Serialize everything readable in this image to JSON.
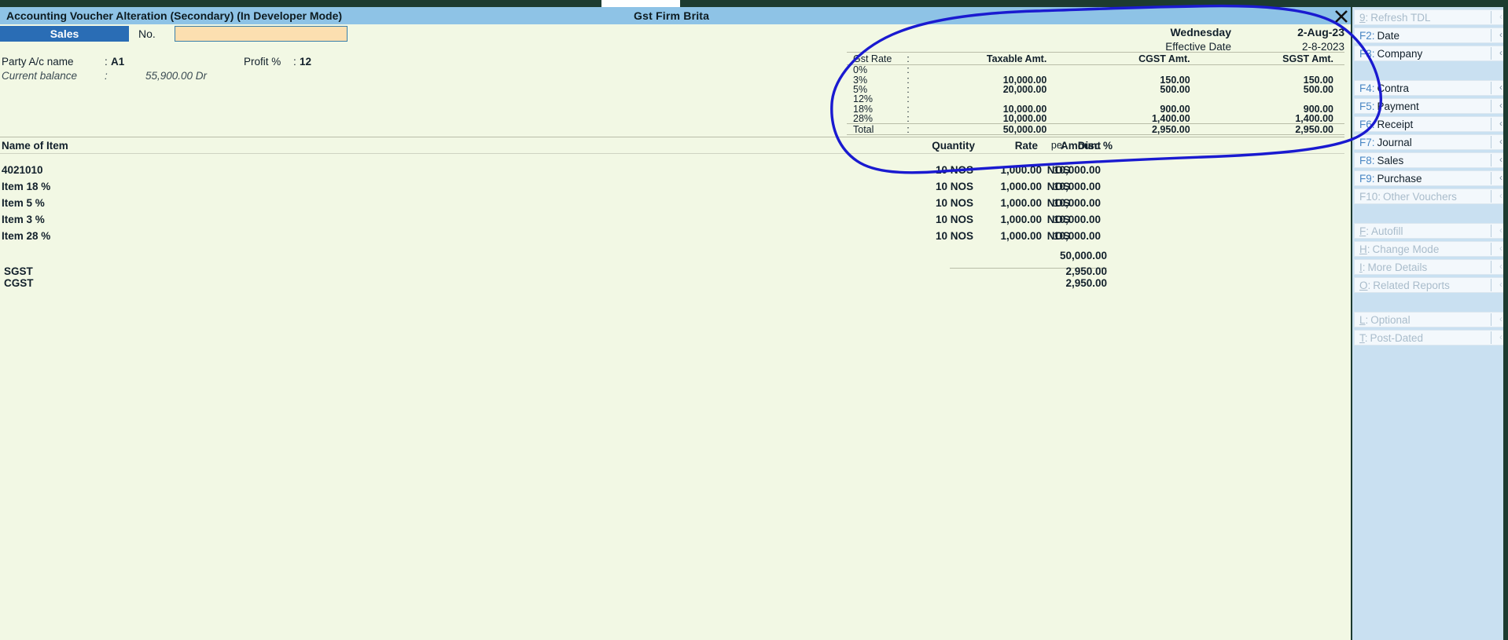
{
  "window": {
    "title": "Accounting Voucher Alteration (Secondary) (In Developer Mode)",
    "company": "Gst Firm  Brita",
    "close_icon": "close-icon"
  },
  "voucher": {
    "type_tag": "Sales",
    "no_label": "No.",
    "no_value": "",
    "party_label": "Party A/c name",
    "party_colon": ":",
    "party_value": "A1",
    "profit_label": "Profit %",
    "profit_colon": ":",
    "profit_value": "12",
    "balance_label": "Current balance",
    "balance_colon": ":",
    "balance_value": "55,900.00 Dr",
    "day": "Wednesday",
    "date": "2-Aug-23",
    "effective_date_label": "Effective Date",
    "effective_date": "2-8-2023"
  },
  "gst_table": {
    "headers": [
      "Gst Rate",
      ":",
      "Taxable Amt.",
      "CGST Amt.",
      "SGST Amt."
    ],
    "rows": [
      {
        "rate": "0%",
        "colon": ":",
        "taxable": "",
        "cgst": "",
        "sgst": ""
      },
      {
        "rate": "3%",
        "colon": ":",
        "taxable": "10,000.00",
        "cgst": "150.00",
        "sgst": "150.00"
      },
      {
        "rate": "5%",
        "colon": ":",
        "taxable": "20,000.00",
        "cgst": "500.00",
        "sgst": "500.00"
      },
      {
        "rate": "12%",
        "colon": ":",
        "taxable": "",
        "cgst": "",
        "sgst": ""
      },
      {
        "rate": "18%",
        "colon": ":",
        "taxable": "10,000.00",
        "cgst": "900.00",
        "sgst": "900.00"
      },
      {
        "rate": "28%",
        "colon": ":",
        "taxable": "10,000.00",
        "cgst": "1,400.00",
        "sgst": "1,400.00"
      }
    ],
    "total": {
      "rate": "Total",
      "colon": ":",
      "taxable": "50,000.00",
      "cgst": "2,950.00",
      "sgst": "2,950.00"
    }
  },
  "items": {
    "headers": {
      "name": "Name of Item",
      "quantity": "Quantity",
      "rate": "Rate",
      "per": "per",
      "disc": "Disc %",
      "amount": "Amount"
    },
    "rows": [
      {
        "name": "4021010",
        "quantity": "10 NOS",
        "rate": "1,000.00",
        "per": "NOS",
        "disc": "",
        "amount": "10,000.00"
      },
      {
        "name": "Item 18 %",
        "quantity": "10 NOS",
        "rate": "1,000.00",
        "per": "NOS",
        "disc": "",
        "amount": "10,000.00"
      },
      {
        "name": "Item 5 %",
        "quantity": "10 NOS",
        "rate": "1,000.00",
        "per": "NOS",
        "disc": "",
        "amount": "10,000.00"
      },
      {
        "name": "Item 3 %",
        "quantity": "10 NOS",
        "rate": "1,000.00",
        "per": "NOS",
        "disc": "",
        "amount": "10,000.00"
      },
      {
        "name": "Item 28 %",
        "quantity": "10 NOS",
        "rate": "1,000.00",
        "per": "NOS",
        "disc": "",
        "amount": "10,000.00"
      }
    ],
    "subtotal": "50,000.00",
    "taxes": [
      {
        "name": "SGST",
        "amount": "2,950.00"
      },
      {
        "name": "CGST",
        "amount": "2,950.00"
      }
    ]
  },
  "sidebar": {
    "groups": [
      {
        "items": [
          {
            "key": "9",
            "underline": "9",
            "label": "Refresh TDL",
            "chevron": "‹",
            "disabled": true
          },
          {
            "key": "F2",
            "underline": "",
            "label": "Date",
            "chevron": "‹",
            "disabled": false
          },
          {
            "key": "F3",
            "underline": "",
            "label": "Company",
            "chevron": "‹",
            "disabled": false
          }
        ]
      },
      {
        "items": [
          {
            "key": "F4",
            "underline": "",
            "label": "Contra",
            "chevron": "‹",
            "disabled": false
          },
          {
            "key": "F5",
            "underline": "",
            "label": "Payment",
            "chevron": "‹",
            "disabled": false
          },
          {
            "key": "F6",
            "underline": "",
            "label": "Receipt",
            "chevron": "‹",
            "disabled": false
          },
          {
            "key": "F7",
            "underline": "",
            "label": "Journal",
            "chevron": "‹",
            "disabled": false
          },
          {
            "key": "F8",
            "underline": "",
            "label": "Sales",
            "chevron": "‹",
            "disabled": false
          },
          {
            "key": "F9",
            "underline": "",
            "label": "Purchase",
            "chevron": "‹",
            "disabled": false
          },
          {
            "key": "F10",
            "underline": "",
            "label": "Other Vouchers",
            "chevron": "‹",
            "disabled": true
          }
        ]
      },
      {
        "items": [
          {
            "key": "F",
            "underline": "F",
            "label": "Autofill",
            "chevron": "‹",
            "disabled": true
          },
          {
            "key": "H",
            "underline": "H",
            "label": "Change Mode",
            "chevron": "‹",
            "disabled": true
          },
          {
            "key": "I",
            "underline": "I",
            "label": "More Details",
            "chevron": "‹",
            "disabled": true
          },
          {
            "key": "O",
            "underline": "O",
            "label": "Related Reports",
            "chevron": "‹",
            "disabled": true
          }
        ]
      },
      {
        "items": [
          {
            "key": "L",
            "underline": "L",
            "label": "Optional",
            "chevron": "‹",
            "disabled": true
          },
          {
            "key": "T",
            "underline": "T",
            "label": "Post-Dated",
            "chevron": "‹",
            "disabled": true
          }
        ]
      }
    ]
  },
  "annotation": {
    "color": "#1a1ad0",
    "shape": "hand-drawn-ellipse-around-gst-summary"
  }
}
